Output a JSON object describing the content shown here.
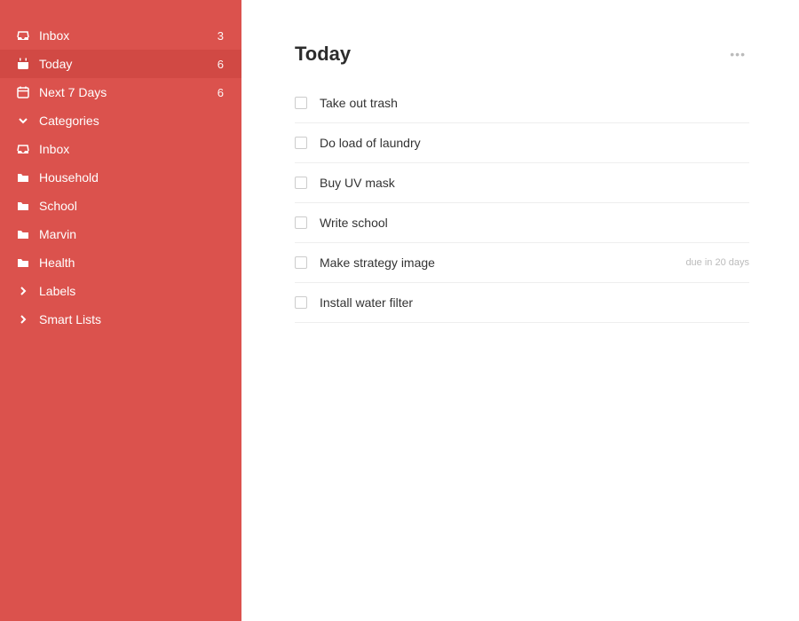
{
  "sidebar": {
    "primary": [
      {
        "icon": "inbox",
        "label": "Inbox",
        "count": "3",
        "active": false
      },
      {
        "icon": "today",
        "label": "Today",
        "count": "6",
        "active": true
      },
      {
        "icon": "calendar",
        "label": "Next 7 Days",
        "count": "6",
        "active": false
      }
    ],
    "categoriesHeader": {
      "icon": "chevron-down",
      "label": "Categories"
    },
    "categories": [
      {
        "icon": "inbox",
        "label": "Inbox"
      },
      {
        "icon": "folder",
        "label": "Household"
      },
      {
        "icon": "folder",
        "label": "School"
      },
      {
        "icon": "folder",
        "label": "Marvin"
      },
      {
        "icon": "folder",
        "label": "Health"
      }
    ],
    "labelsHeader": {
      "icon": "chevron-right",
      "label": "Labels"
    },
    "smartListsHeader": {
      "icon": "chevron-right",
      "label": "Smart Lists"
    }
  },
  "main": {
    "title": "Today",
    "tasks": [
      {
        "title": "Take out trash",
        "meta": ""
      },
      {
        "title": "Do load of laundry",
        "meta": ""
      },
      {
        "title": "Buy UV  mask",
        "meta": ""
      },
      {
        "title": "Write school",
        "meta": ""
      },
      {
        "title": "Make strategy image",
        "meta": "due in 20 days"
      },
      {
        "title": "Install water filter",
        "meta": ""
      }
    ]
  }
}
